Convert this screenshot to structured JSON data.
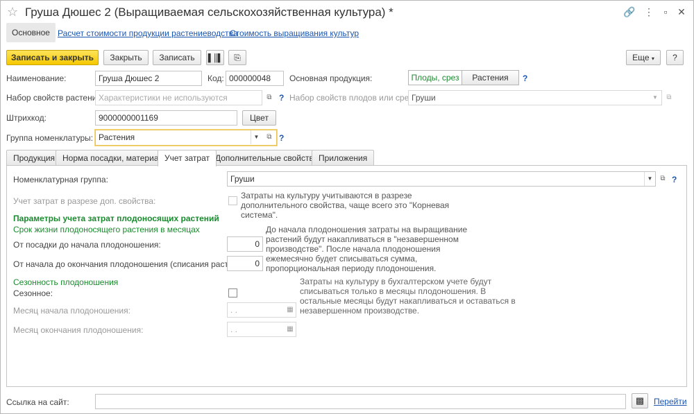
{
  "window": {
    "title": "Груша Дюшес 2 (Выращиваемая сельскохозяйственная культура) *"
  },
  "nav": {
    "main": "Основное",
    "links": [
      "Расчет стоимости продукции растениеводства",
      "Стоимость выращивания культур"
    ]
  },
  "toolbar": {
    "save_close": "Записать и закрыть",
    "close": "Закрыть",
    "save": "Записать",
    "more": "Еще",
    "help": "?"
  },
  "form": {
    "name_label": "Наименование:",
    "name_value": "Груша Дюшес 2",
    "code_label": "Код:",
    "code_value": "000000048",
    "main_product_label": "Основная продукция:",
    "main_product_options": [
      "Плоды, срез",
      "Растения"
    ],
    "plant_props_label": "Набор свойств растения:",
    "plant_props_placeholder": "Характеристики не используются",
    "fruit_props_label": "Набор свойств плодов или среза:",
    "fruit_props_value": "Груши",
    "barcode_label": "Штрихкод:",
    "barcode_value": "9000000001169",
    "color_button": "Цвет",
    "group_label": "Группа номенклатуры:",
    "group_value": "Растения"
  },
  "tabs": [
    "Продукция",
    "Норма посадки, материал",
    "Учет затрат",
    "Дополнительные свойства",
    "Приложения"
  ],
  "cost_tab": {
    "nom_group_label": "Номенклатурная группа:",
    "nom_group_value": "Груши",
    "extra_prop_label": "Учет затрат в разрезе доп. свойства:",
    "extra_prop_note": "Затраты на культуру учитываются в разрезе дополнительного свойства, чаще всего это \"Корневая система\".",
    "params_heading": "Параметры учета затрат плодоносящих растений",
    "lifespan_heading": "Срок жизни плодоносящего растения в месяцах",
    "planting_label": "От посадки до начала плодоношения:",
    "planting_value": "0",
    "fruiting_label": "От начала до окончания плодоношения (списания растения):",
    "fruiting_value": "0",
    "lifespan_note": "До начала плодоношения затраты на выращивание растений будут накапливаться в \"незавершенном производстве\". После начала плодоношения ежемесячно будет списываться сумма, пропорциональная периоду плодоношения.",
    "season_heading": "Сезонность плодоношения",
    "seasonal_label": "Сезонное:",
    "season_note": "Затраты на культуру в бухгалтерском учете будут списываться только в месяцы плодоношения. В остальные месяцы будут накапливаться и оставаться в незавершенном производстве.",
    "start_month_label": "Месяц начала плодоношения:",
    "end_month_label": "Месяц окончания плодоношения:",
    "date_placeholder": " .  ."
  },
  "footer": {
    "site_label": "Ссылка на сайт:",
    "go_link": "Перейти"
  }
}
